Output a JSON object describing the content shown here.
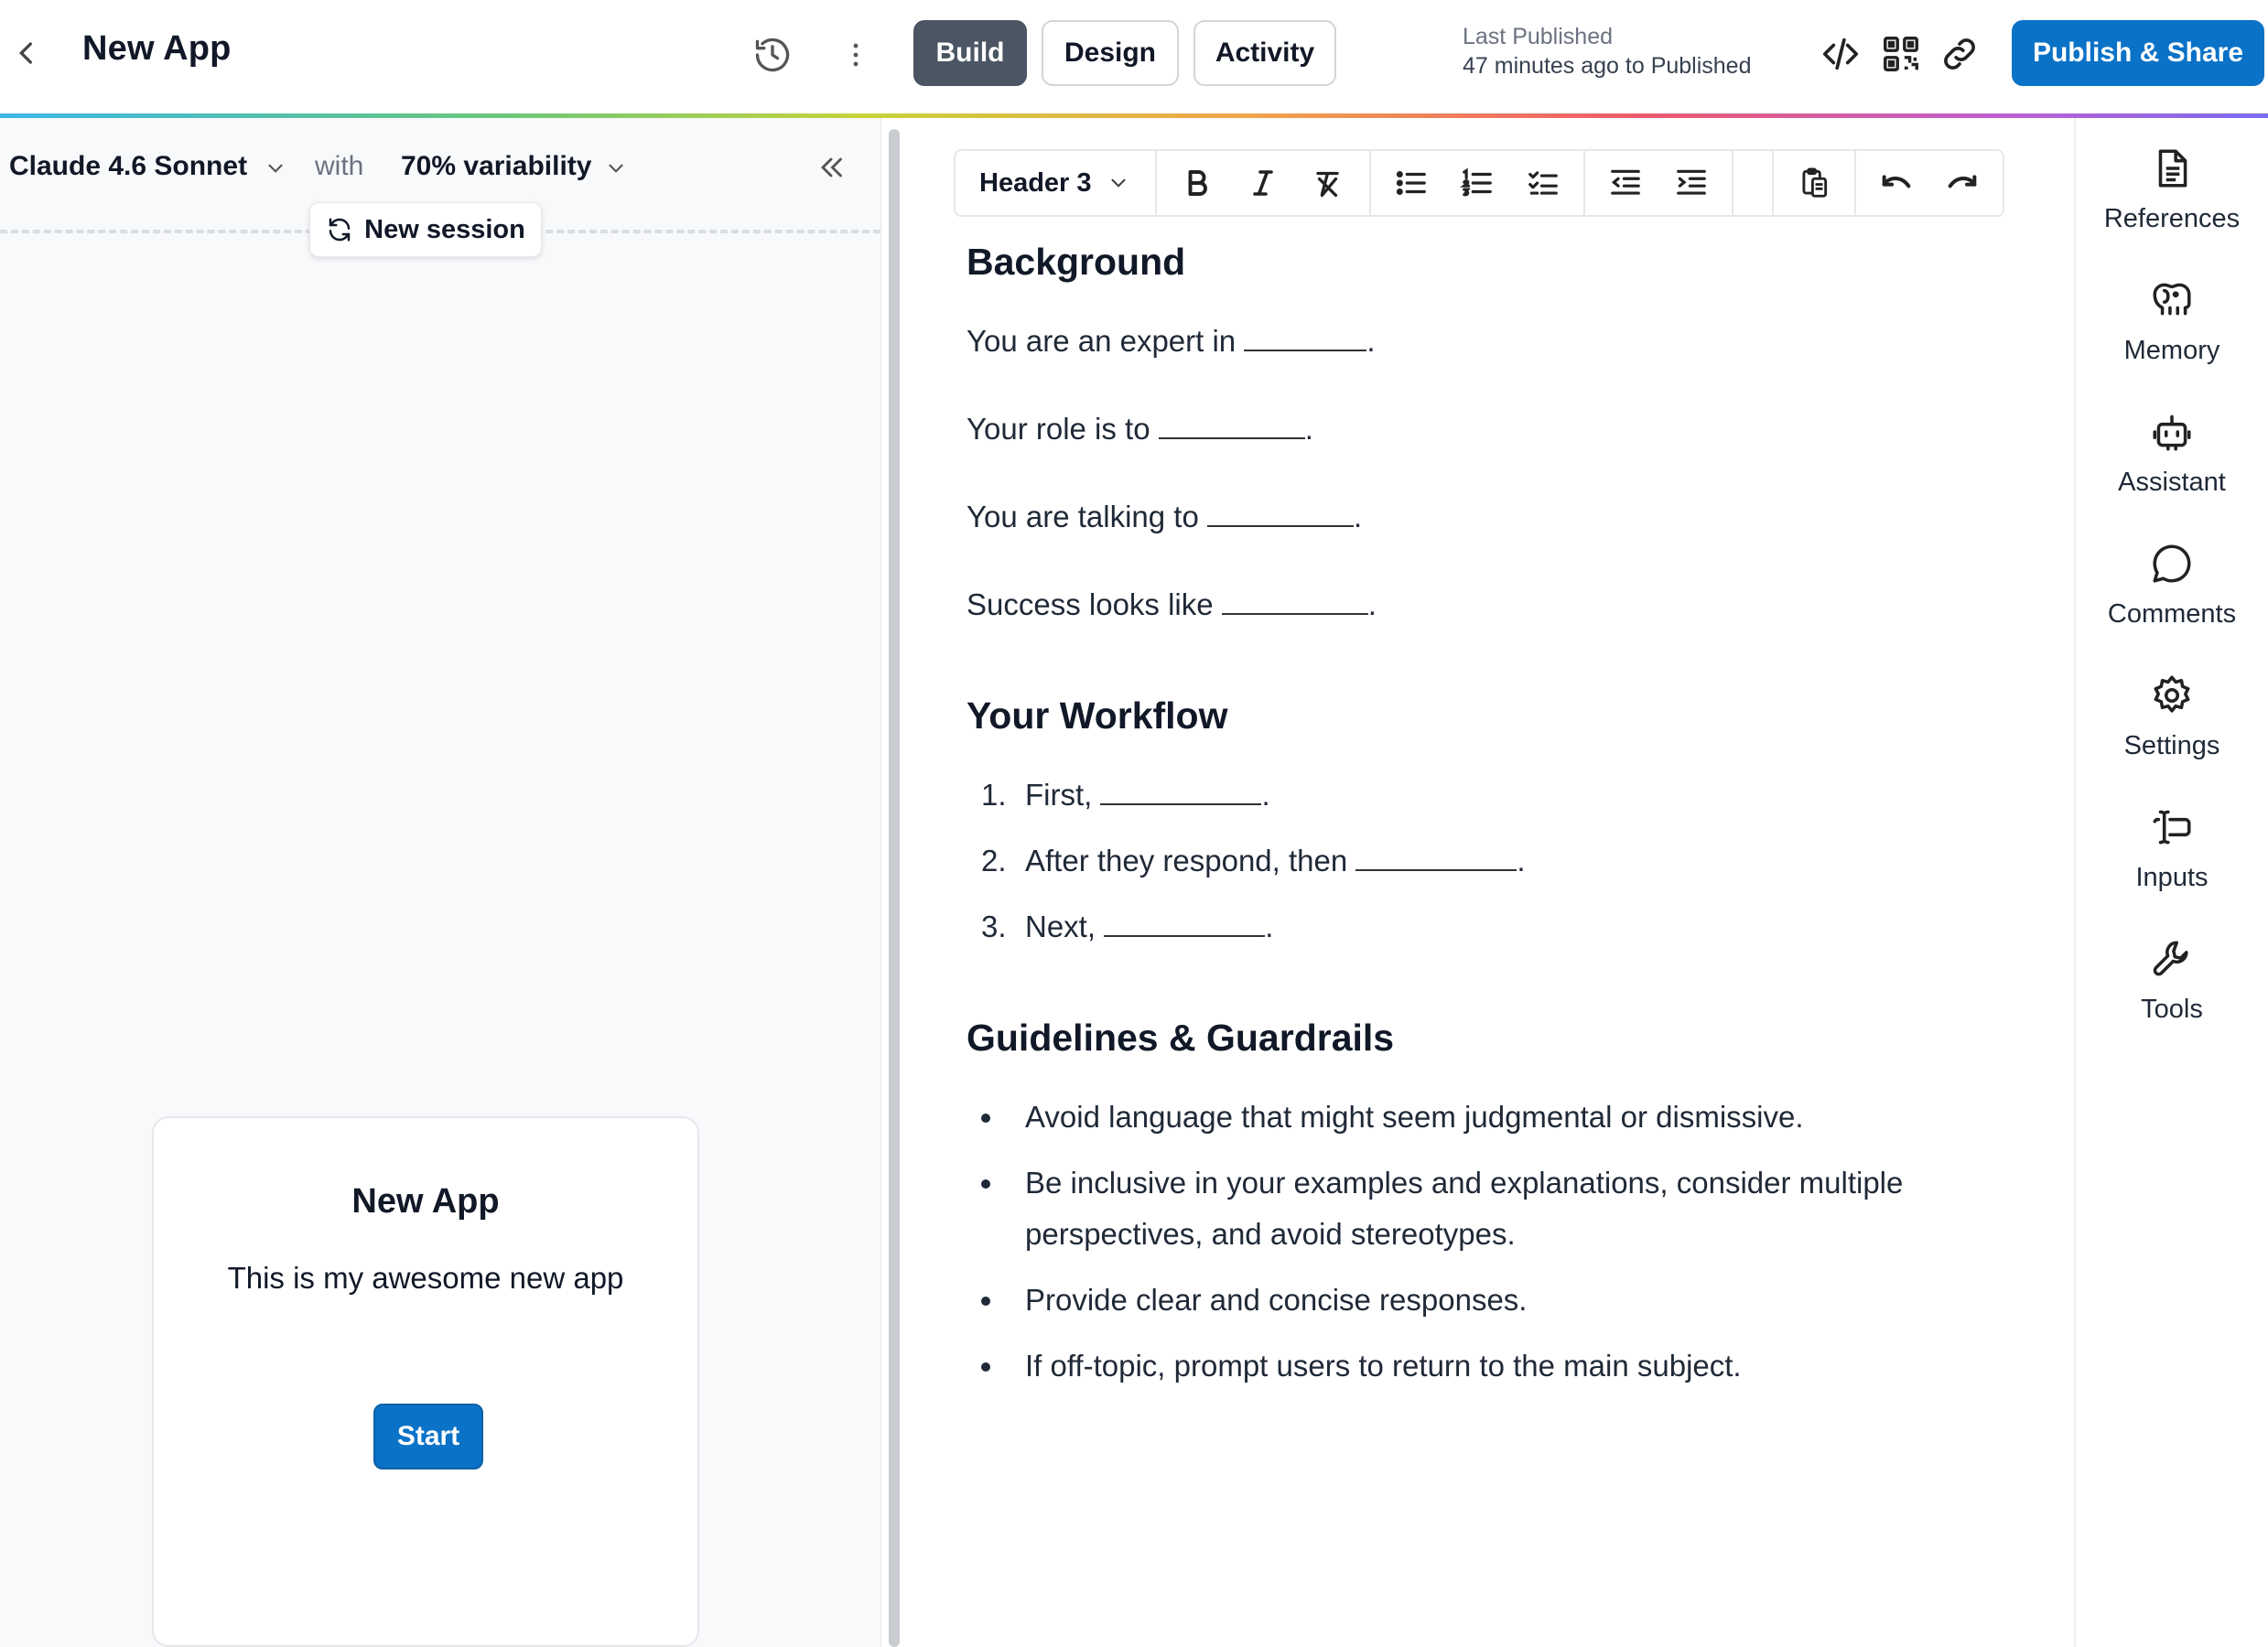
{
  "header": {
    "app_title": "New App",
    "modes": [
      "Build",
      "Design",
      "Activity"
    ],
    "active_mode": "Build",
    "last_published_label": "Last Published",
    "last_published_time": "47 minutes ago to Published",
    "publish_label": "Publish & Share"
  },
  "preview": {
    "model": "Claude 4.6 Sonnet",
    "with_label": "with",
    "variability": "70% variability",
    "new_session_label": "New session",
    "card": {
      "title": "New App",
      "description": "This is my awesome new app",
      "start_label": "Start"
    }
  },
  "toolbar": {
    "block_type": "Header 3"
  },
  "document": {
    "background": {
      "heading": "Background",
      "lines": [
        "You are an expert in ",
        "Your role is to ",
        "You are talking to ",
        "Success looks like "
      ]
    },
    "workflow": {
      "heading": "Your Workflow",
      "numbers": [
        "1.",
        "2.",
        "3."
      ],
      "steps": [
        "First, ",
        "After they respond, then ",
        "Next, "
      ]
    },
    "guidelines": {
      "heading": "Guidelines & Guardrails",
      "items": [
        "Avoid language that might seem judgmental or dismissive.",
        "Be inclusive in your examples and explanations, consider multiple",
        "perspectives, and avoid stereotypes.",
        "Provide clear and concise responses.",
        "If off-topic, prompt users to return to the main subject."
      ]
    }
  },
  "rail": {
    "items": [
      "References",
      "Memory",
      "Assistant",
      "Comments",
      "Settings",
      "Inputs",
      "Tools"
    ]
  },
  "colors": {
    "primary": "#0a72c7",
    "active_mode_bg": "#4b5563",
    "panel_bg": "#f8f9fb"
  }
}
